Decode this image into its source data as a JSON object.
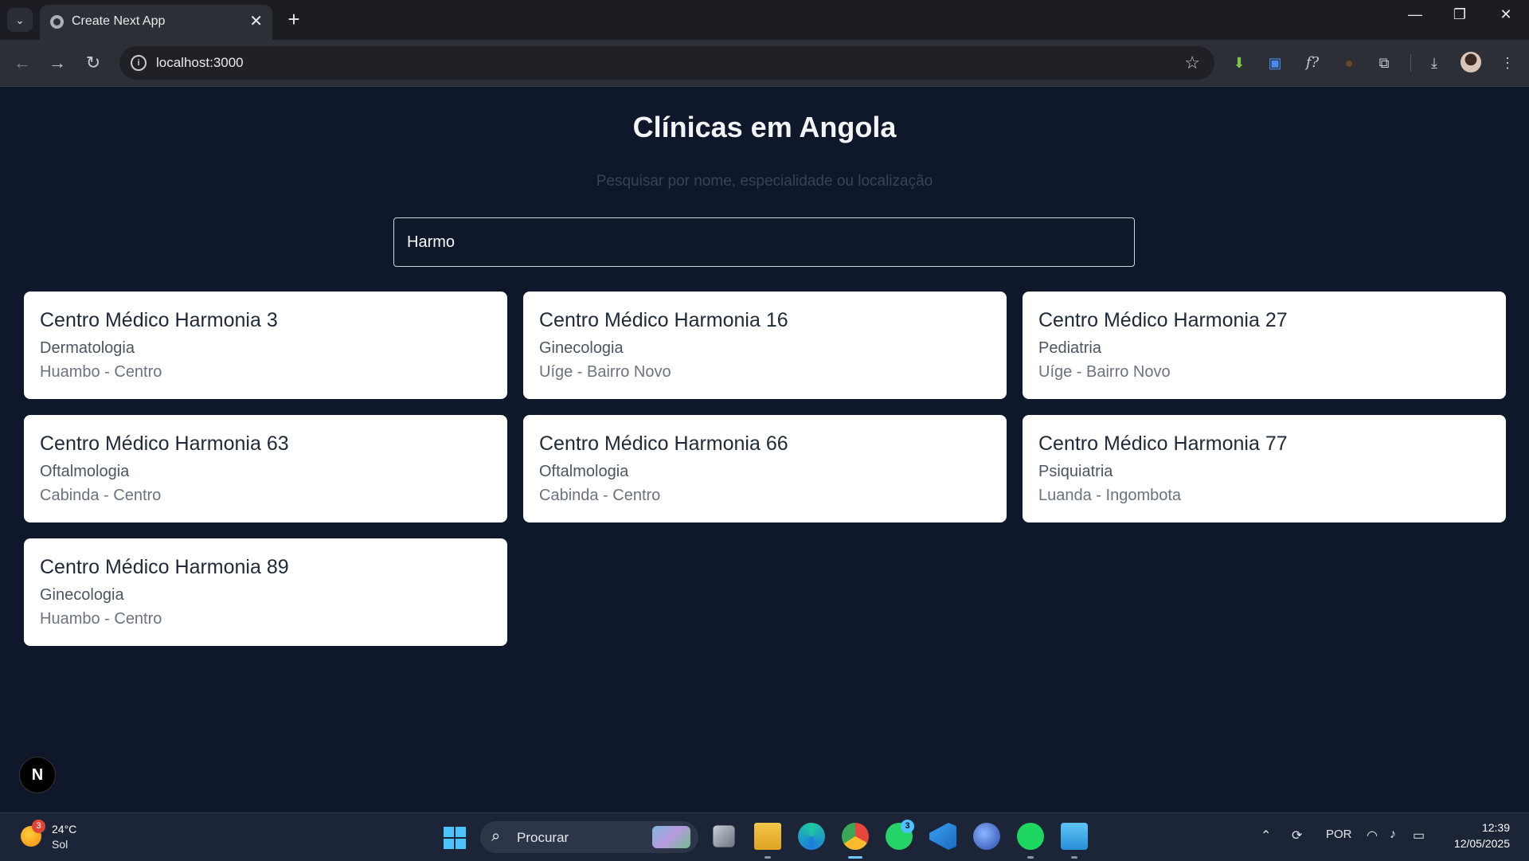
{
  "browser": {
    "tab_title": "Create Next App",
    "tab_close": "✕",
    "new_tab": "+",
    "url": "localhost:3000",
    "window_controls": {
      "minimize": "—",
      "maximize": "❐",
      "close": "✕"
    }
  },
  "page": {
    "title": "Clínicas em Angola",
    "search_hint": "Pesquisar por nome, especialidade ou localização",
    "search_value": "Harmo",
    "clinics": [
      {
        "name": "Centro Médico Harmonia 3",
        "specialty": "Dermatologia",
        "location": "Huambo - Centro"
      },
      {
        "name": "Centro Médico Harmonia 16",
        "specialty": "Ginecologia",
        "location": "Uíge - Bairro Novo"
      },
      {
        "name": "Centro Médico Harmonia 27",
        "specialty": "Pediatria",
        "location": "Uíge - Bairro Novo"
      },
      {
        "name": "Centro Médico Harmonia 63",
        "specialty": "Oftalmologia",
        "location": "Cabinda - Centro"
      },
      {
        "name": "Centro Médico Harmonia 66",
        "specialty": "Oftalmologia",
        "location": "Cabinda - Centro"
      },
      {
        "name": "Centro Médico Harmonia 77",
        "specialty": "Psiquiatria",
        "location": "Luanda - Ingombota"
      },
      {
        "name": "Centro Médico Harmonia 89",
        "specialty": "Ginecologia",
        "location": "Huambo - Centro"
      }
    ],
    "next_badge": "N"
  },
  "taskbar": {
    "weather_temp": "24°C",
    "weather_desc": "Sol",
    "weather_badge": "3",
    "search_label": "Procurar",
    "whatsapp_badge": "3",
    "language": "POR",
    "time": "12:39",
    "date": "12/05/2025"
  },
  "colors": {
    "page_background": "#0f172a",
    "card_background": "#ffffff",
    "title_text": "#f3f4f6"
  }
}
